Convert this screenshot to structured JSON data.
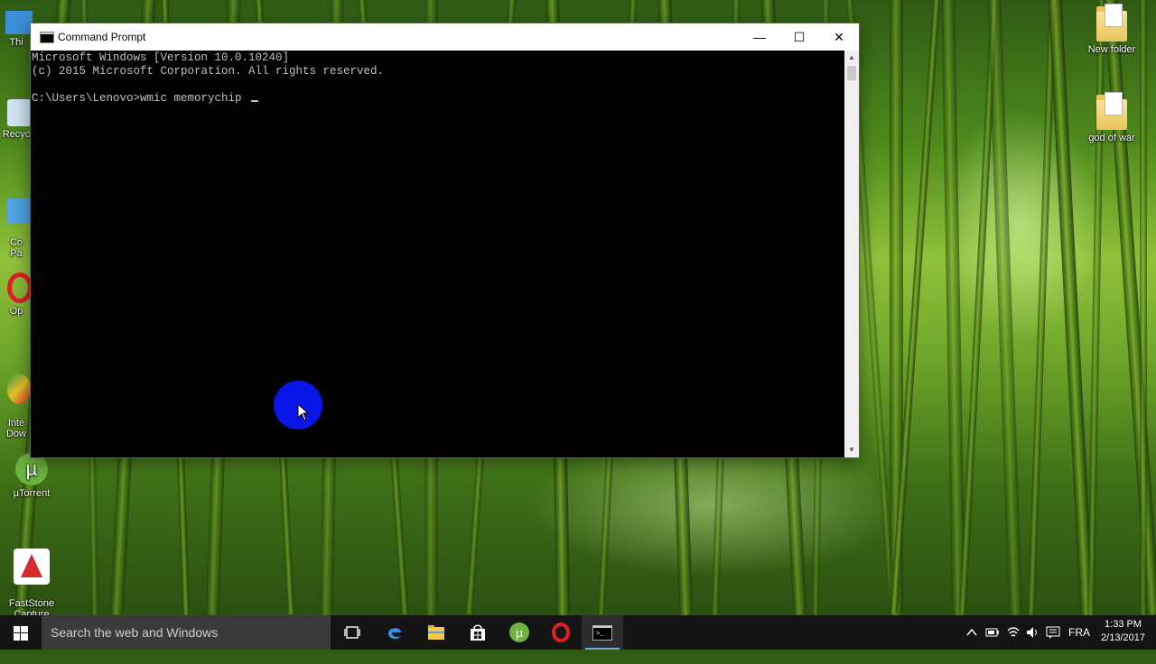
{
  "desktop": {
    "icons_left": [
      {
        "label": "Thi"
      },
      {
        "label": "Recyc"
      },
      {
        "label": "Co\nPa"
      },
      {
        "label": "Op"
      },
      {
        "label": "Inte\nDow"
      },
      {
        "label": "µTorrent"
      },
      {
        "label": "FastStone\nCapture"
      }
    ],
    "icons_right": [
      {
        "label": "New folder"
      },
      {
        "label": "god of war"
      }
    ]
  },
  "window": {
    "title": "Command Prompt",
    "minimize": "—",
    "maximize": "☐",
    "close": "✕",
    "lines": [
      "Microsoft Windows [Version 10.0.10240]",
      "(c) 2015 Microsoft Corporation. All rights reserved.",
      "",
      "C:\\Users\\Lenovo>wmic memorychip "
    ]
  },
  "taskbar": {
    "search_placeholder": "Search the web and Windows",
    "language": "FRA",
    "time": "1:33 PM",
    "date": "2/13/2017"
  },
  "colors": {
    "accent": "#1e6fb8",
    "click_marker": "#0a16e8"
  }
}
